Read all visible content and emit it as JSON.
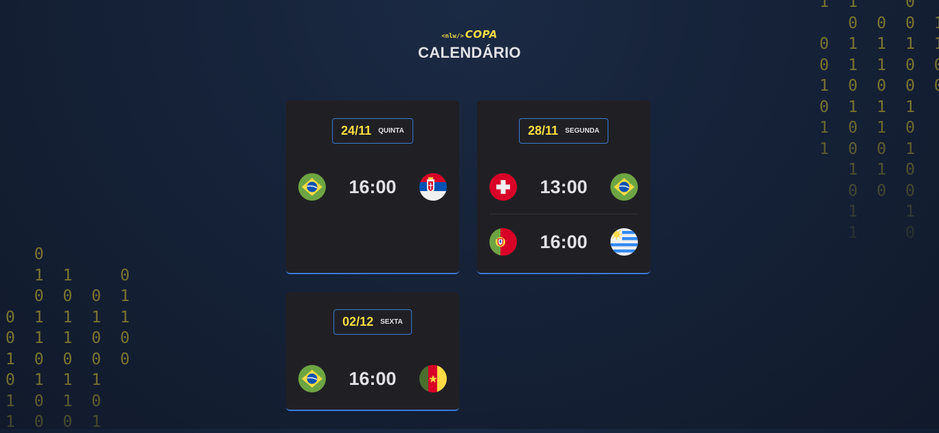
{
  "header": {
    "logo_tag": "<nlw/>",
    "logo_name": "COPA",
    "title": "CALENDÁRIO"
  },
  "decor": {
    "binary_right": "1 1   0\n  0 0 0 1\n0 1 1 1 1\n0 1 1 0 0\n1 0 0 0 0\n0 1 1 1\n1 0 1 0\n1 0 0 1\n  1 1 0\n  0 0 0\n  1   1\n  1   0",
    "binary_left": "  0\n  1 1   0\n  0 0 0 1\n0 1 1 1 1\n0 1 1 0 0\n1 0 0 0 0\n0 1 1 1\n1 0 1 0\n1 0 0 1"
  },
  "cards": [
    {
      "date": "24/11",
      "weekday": "quinta",
      "matches": [
        {
          "home": "brazil-flag-icon",
          "time": "16:00",
          "away": "serbia-flag-icon"
        }
      ]
    },
    {
      "date": "28/11",
      "weekday": "segunda",
      "matches": [
        {
          "home": "switzerland-flag-icon",
          "time": "13:00",
          "away": "brazil-flag-icon"
        },
        {
          "home": "portugal-flag-icon",
          "time": "16:00",
          "away": "uruguay-flag-icon"
        }
      ]
    },
    {
      "date": "02/12",
      "weekday": "sexta",
      "matches": [
        {
          "home": "brazil-flag-icon",
          "time": "16:00",
          "away": "cameroon-flag-icon"
        }
      ]
    }
  ],
  "colors": {
    "accent_yellow": "#f7dd43",
    "accent_blue": "#3a7ad6",
    "card_bg": "#202024",
    "text": "#e1e1e6"
  }
}
